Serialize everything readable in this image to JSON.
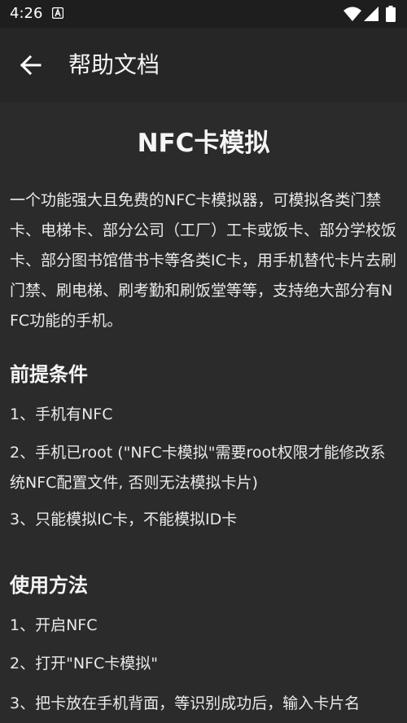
{
  "status_bar": {
    "time": "4:26",
    "icons": [
      "notification-a-icon",
      "wifi-icon",
      "cell-signal-icon",
      "battery-icon"
    ]
  },
  "app_bar": {
    "back_icon": "arrow-left-icon",
    "title": "帮助文档"
  },
  "document": {
    "title": "NFC卡模拟",
    "intro": "一个功能强大且免费的NFC卡模拟器，可模拟各类门禁卡、电梯卡、部分公司（工厂）工卡或饭卡、部分学校饭卡、部分图书馆借书卡等各类IC卡，用手机替代卡片去刷门禁、刷电梯、刷考勤和刷饭堂等等，支持绝大部分有NFC功能的手机。",
    "sections": [
      {
        "heading": "前提条件",
        "items": [
          "1、手机有NFC",
          "2、手机已root (\"NFC卡模拟\"需要root权限才能修改系统NFC配置文件, 否则无法模拟卡片)",
          "3、只能模拟IC卡，不能模拟ID卡"
        ]
      },
      {
        "heading": "使用方法",
        "items": [
          "1、开启NFC",
          "2、打开\"NFC卡模拟\"",
          "3、把卡放在手机背面，等识别成功后，输入卡片名"
        ]
      }
    ]
  },
  "colors": {
    "background": "#2b2b2b",
    "app_bar": "#262626",
    "status_bar": "#1e1e1e",
    "text": "#e9e9e9"
  }
}
